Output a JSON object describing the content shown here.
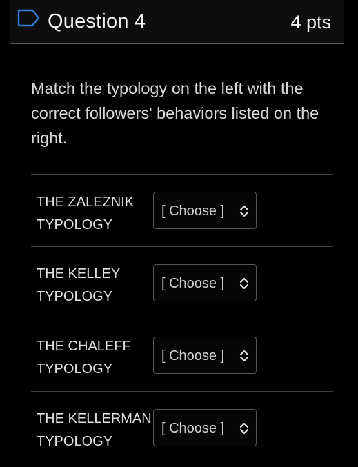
{
  "question": {
    "title": "Question 4",
    "points": "4 pts",
    "prompt": "Match the typology on the left with the correct followers' behaviors listed on the right."
  },
  "matches": [
    {
      "label": "THE ZALEZNIK TYPOLOGY",
      "select_value": "[ Choose ]"
    },
    {
      "label": "THE KELLEY TYPOLOGY",
      "select_value": "[ Choose ]"
    },
    {
      "label": "THE CHALEFF TYPOLOGY",
      "select_value": "[ Choose ]"
    },
    {
      "label": "THE KELLERMAN TYPOLOGY",
      "select_value": "[ Choose ]"
    }
  ],
  "icons": {
    "flag": "flag-outline-icon",
    "select": "chevron-up-down-icon"
  },
  "colors": {
    "background": "#000000",
    "border": "#5a5a5a",
    "text": "#e6e6e6"
  }
}
